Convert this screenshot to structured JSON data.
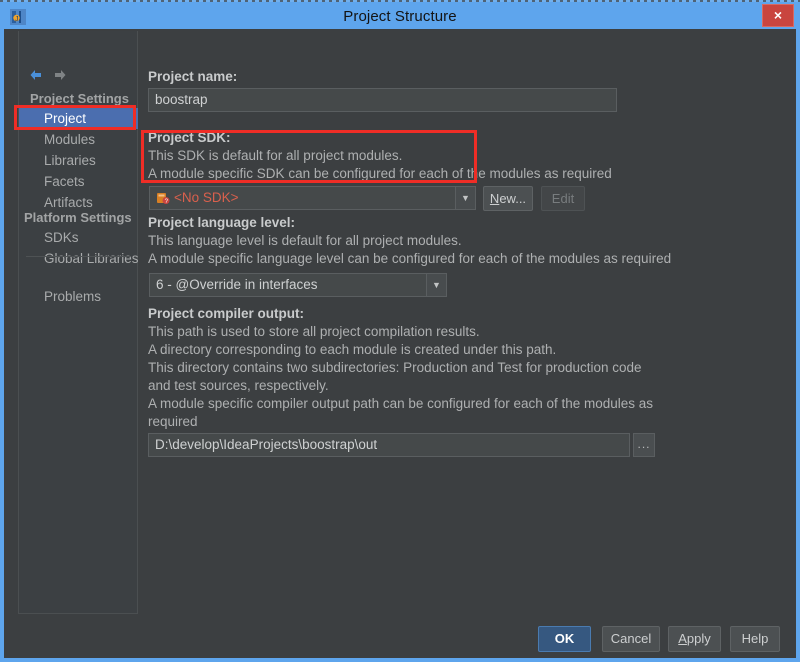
{
  "window": {
    "title": "Project Structure",
    "app_icon": "intellij-idea-icon",
    "close_label": "×"
  },
  "sidebar": {
    "nav": {
      "back_icon": "arrow-left-icon",
      "forward_icon": "arrow-right-icon"
    },
    "groups": [
      {
        "title": "Project Settings",
        "items": [
          {
            "label": "Project",
            "selected": true
          },
          {
            "label": "Modules",
            "selected": false
          },
          {
            "label": "Libraries",
            "selected": false
          },
          {
            "label": "Facets",
            "selected": false
          },
          {
            "label": "Artifacts",
            "selected": false
          }
        ]
      },
      {
        "title": "Platform Settings",
        "items": [
          {
            "label": "SDKs",
            "selected": false
          },
          {
            "label": "Global Libraries",
            "selected": false
          }
        ]
      }
    ],
    "extra_items": [
      {
        "label": "Problems",
        "selected": false
      }
    ]
  },
  "main": {
    "project_name": {
      "label": "Project name:",
      "value": "boostrap",
      "placeholder": ""
    },
    "project_sdk": {
      "label": "Project SDK:",
      "desc": [
        "This SDK is default for all project modules.",
        "A module specific SDK can be configured for each of the modules as required"
      ],
      "value": "<No SDK>",
      "value_color": "#d9604d",
      "icon": "sdk-warning-icon",
      "new_button": {
        "prefix": "N",
        "suffix": "ew..."
      },
      "edit_button": "Edit",
      "edit_enabled": false
    },
    "language_level": {
      "label": "Project language level:",
      "desc": [
        "This language level is default for all project modules.",
        "A module specific language level can be configured for each of the modules as required"
      ],
      "value": "6 - @Override in interfaces"
    },
    "compiler_output": {
      "label": "Project compiler output:",
      "desc": [
        "This path is used to store all project compilation results.",
        "A directory corresponding to each module is created under this path.",
        "This directory contains two subdirectories: Production and Test for production code",
        "and test sources, respectively.",
        "A module specific compiler output path can be configured for each of the modules as",
        "required"
      ],
      "value": "D:\\develop\\IdeaProjects\\boostrap\\out",
      "browse_label": "..."
    }
  },
  "footer": {
    "ok": "OK",
    "cancel": "Cancel",
    "apply": {
      "prefix": "A",
      "suffix": "pply"
    },
    "help": "Help"
  },
  "annotations": {
    "project_item_box": "red-highlight-box",
    "sdk_box": "red-highlight-box"
  },
  "colors": {
    "titlebar": "#5ea5ed",
    "close": "#c9453f",
    "panel": "#3c3f41",
    "selection": "#4b6eaf",
    "primary_button": "#365880",
    "annotation": "#ef2d26",
    "error_text": "#d9604d"
  }
}
